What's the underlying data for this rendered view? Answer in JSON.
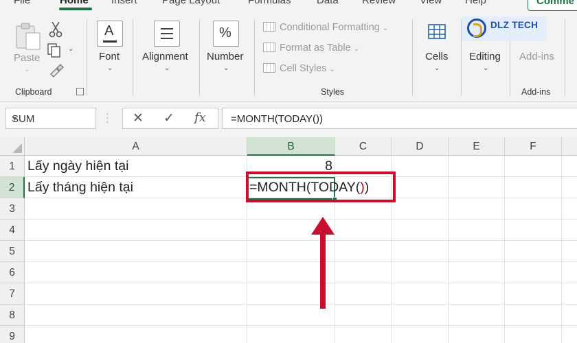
{
  "tabs": {
    "items": [
      "File",
      "Home",
      "Insert",
      "Page Layout",
      "Formulas",
      "Data",
      "Review",
      "View",
      "Help"
    ],
    "active": "Home",
    "comments_label": "Comme"
  },
  "ribbon": {
    "clipboard": {
      "paste_label": "Paste",
      "group_label": "Clipboard"
    },
    "font": {
      "label": "Font",
      "icon_letter": "A"
    },
    "alignment": {
      "label": "Alignment"
    },
    "number": {
      "label": "Number",
      "icon_symbol": "%"
    },
    "styles": {
      "conditional_formatting": "Conditional Formatting",
      "format_as_table": "Format as Table",
      "cell_styles": "Cell Styles",
      "group_label": "Styles"
    },
    "cells": {
      "label": "Cells"
    },
    "editing": {
      "label": "Editing"
    },
    "addins": {
      "label": "Add-ins",
      "group_label": "Add-ins"
    }
  },
  "formula_bar": {
    "name_box": "SUM",
    "cancel_symbol": "✕",
    "enter_symbol": "✓",
    "fx_symbol": "fx",
    "formula": "=MONTH(TODAY())"
  },
  "sheet": {
    "columns": [
      "A",
      "B",
      "C",
      "D",
      "E",
      "F"
    ],
    "rows": [
      "1",
      "2",
      "3",
      "4",
      "5",
      "6",
      "7",
      "8",
      "9"
    ],
    "cells": {
      "A1": "Lấy ngày hiện tại",
      "B1": "8",
      "A2": "Lấy tháng hiện tại",
      "B2_prefix": "=MONTH(TODAY(",
      "B2_open_paren": ")",
      "B2_close_paren": ")"
    },
    "active_cell": "B2"
  },
  "watermark": {
    "brand": "DLZ TECH"
  },
  "colors": {
    "excel_green": "#217346",
    "annotation_red": "#c8102e"
  }
}
